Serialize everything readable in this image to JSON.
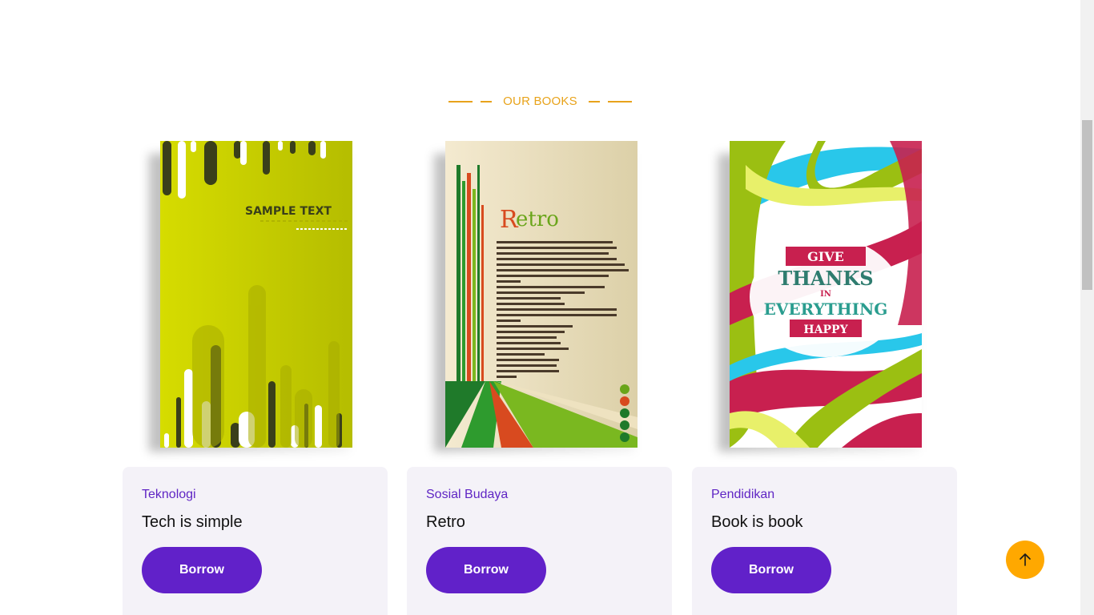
{
  "section": {
    "title": "OUR BOOKS"
  },
  "books": [
    {
      "category": "Teknologi",
      "title": "Tech is simple",
      "button": "Borrow",
      "cover_text": "SAMPLE TEXT",
      "cover_color": "#c8d400"
    },
    {
      "category": "Sosial Budaya",
      "title": "Retro",
      "button": "Borrow",
      "cover_text": "Retro",
      "cover_color": "#efe3bf"
    },
    {
      "category": "Pendidikan",
      "title": "Book is book",
      "button": "Borrow",
      "cover_text_1": "GIVE",
      "cover_text_2": "THANKS",
      "cover_text_3": "IN",
      "cover_text_4": "EVERYTHING",
      "cover_text_5": "HAPPY",
      "cover_color": "#ffffff"
    }
  ],
  "colors": {
    "accent": "#e8a31b",
    "primary": "#6121c9",
    "card_bg": "#f4f2f8",
    "back_to_top": "#ffa800"
  },
  "icons": {
    "back_to_top": "arrow-up-icon"
  }
}
